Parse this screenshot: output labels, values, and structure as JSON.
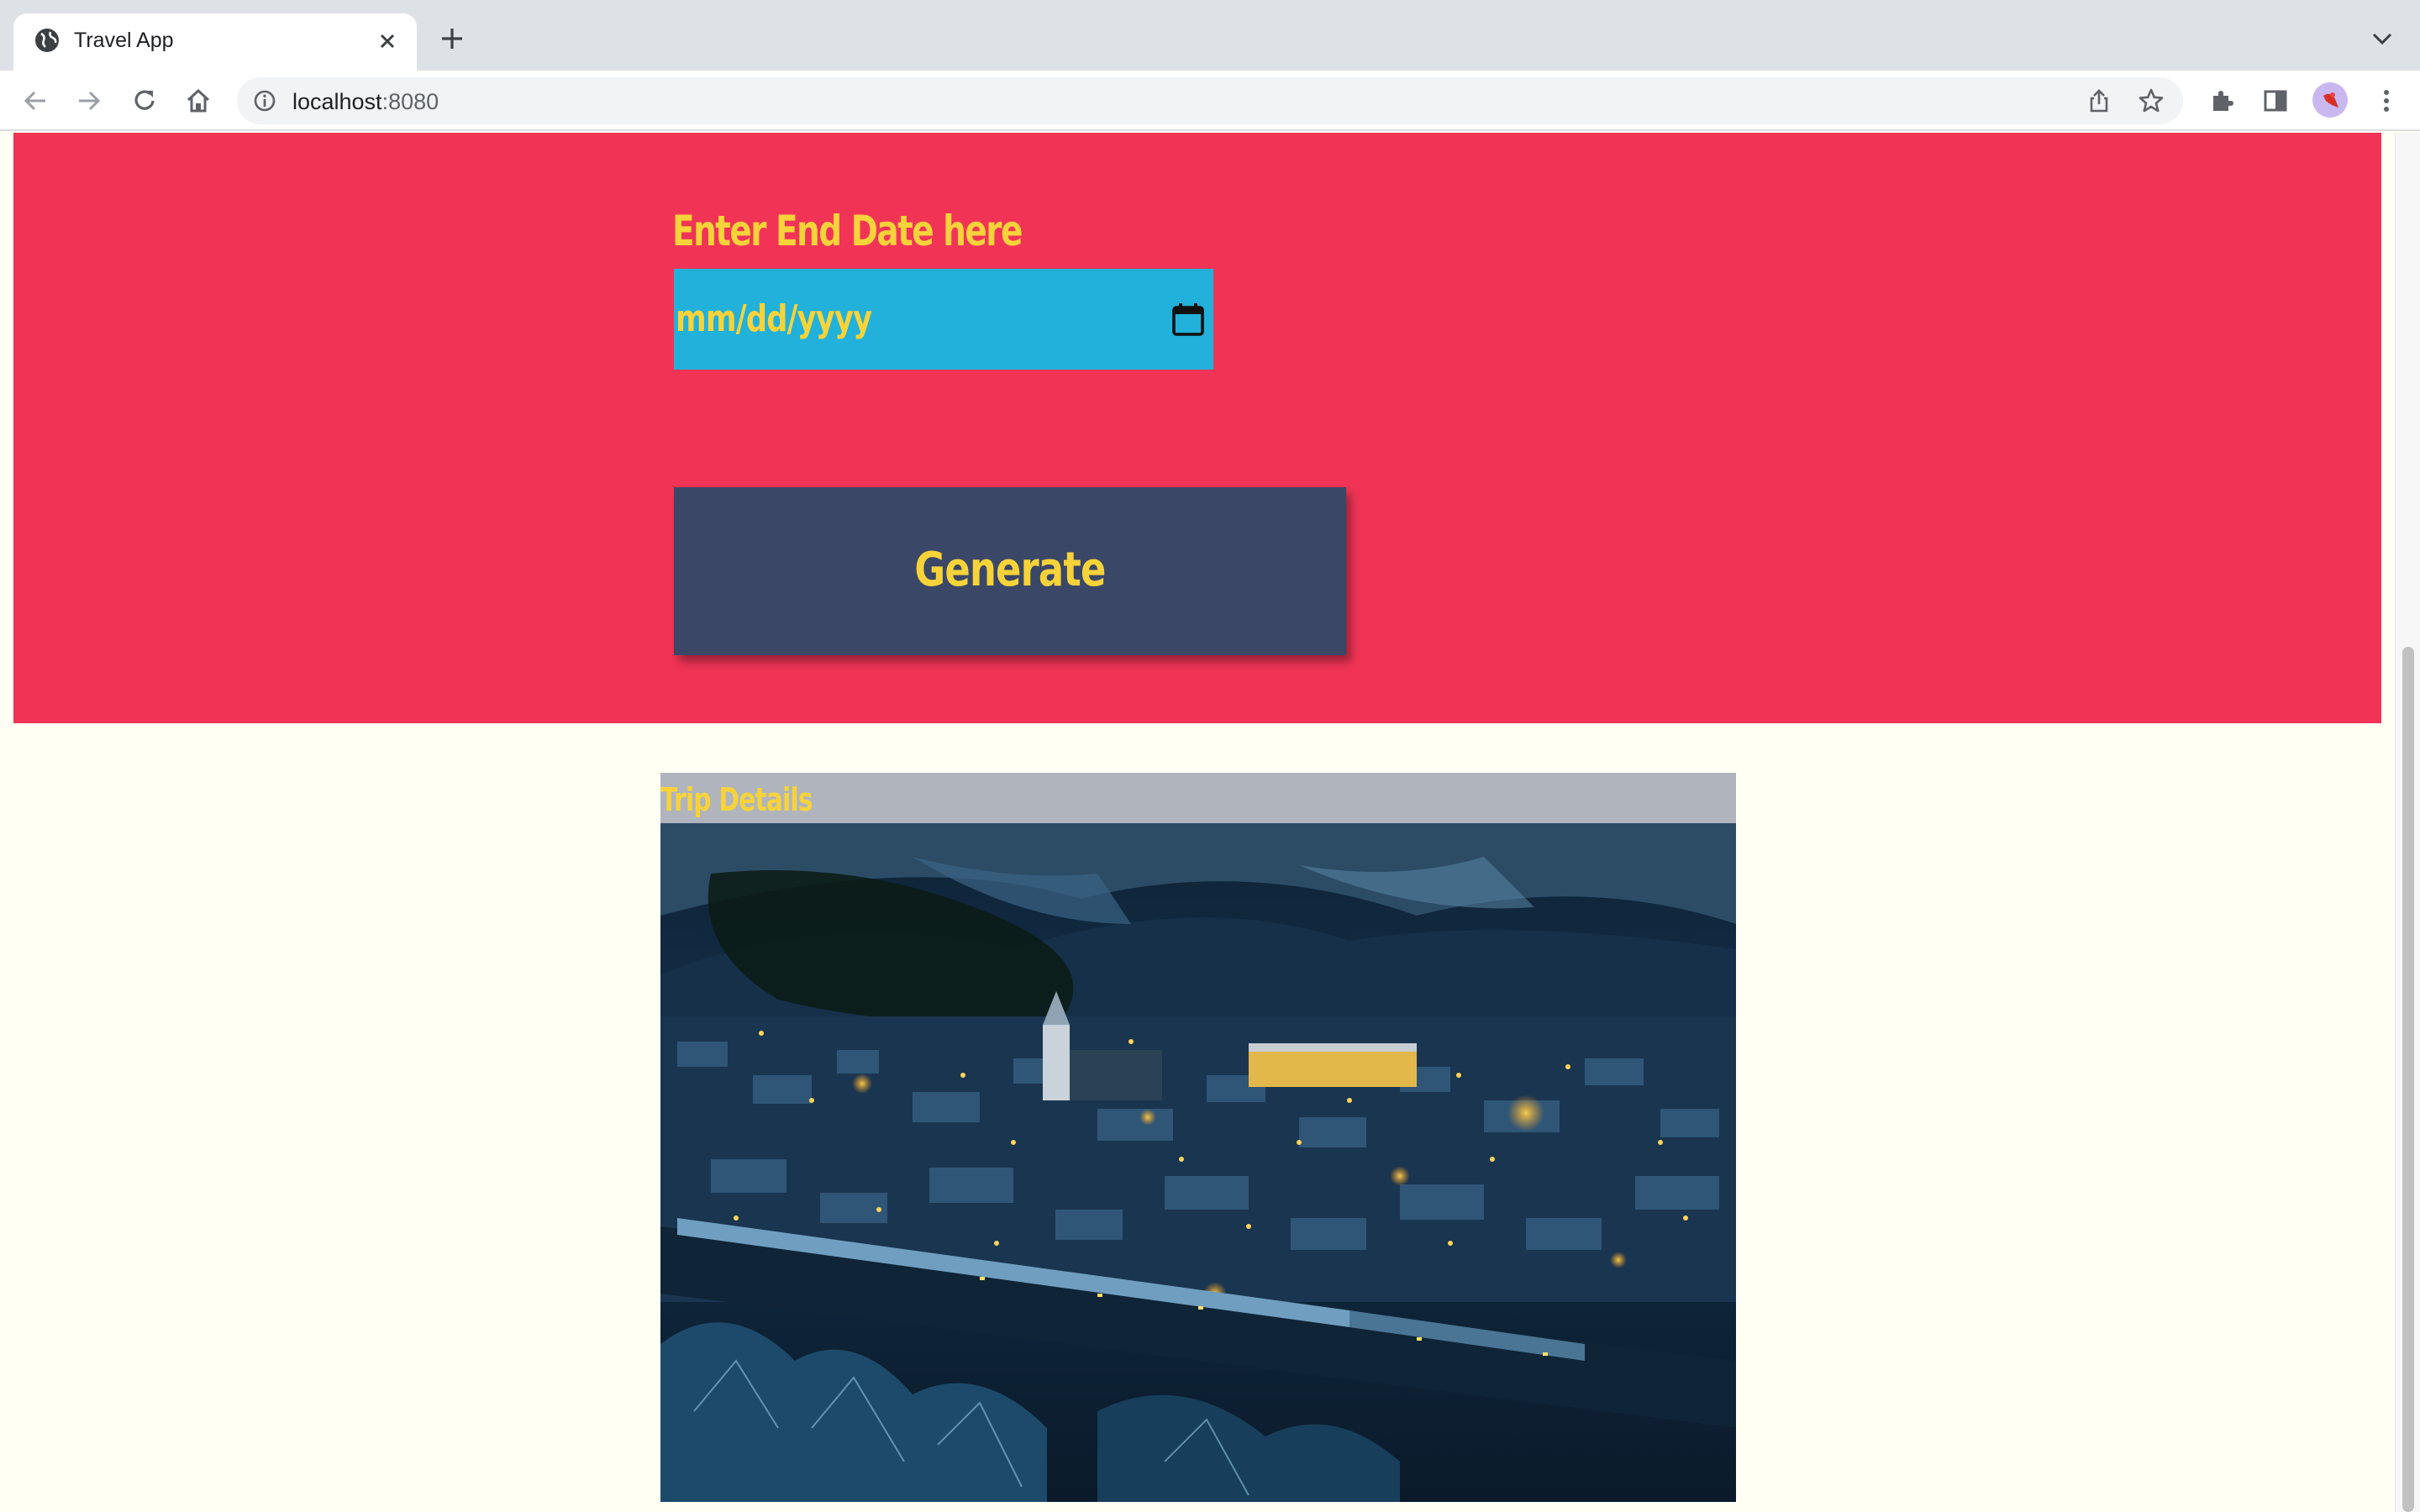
{
  "browser": {
    "tab_title": "Travel App",
    "url_host": "localhost",
    "url_port": ":8080"
  },
  "form": {
    "end_date_label": "Enter End Date here",
    "end_date_placeholder": "mm/dd/yyyy",
    "generate_label": "Generate"
  },
  "trip": {
    "header": "Trip Details",
    "photo_alt": "city-at-night"
  },
  "colors": {
    "hero_bg": "#f13456",
    "accent_text": "#f7d33a",
    "date_input_bg": "#21b1da",
    "button_bg": "#3b4766",
    "page_bg": "#fffff4"
  }
}
